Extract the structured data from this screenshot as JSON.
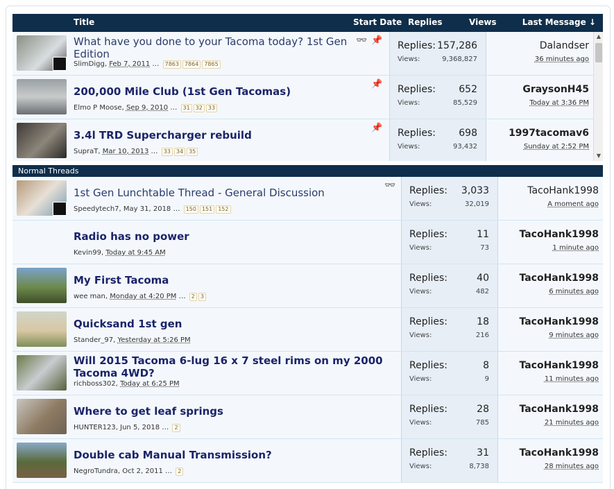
{
  "header": {
    "title": "Title",
    "start_date": "Start Date",
    "replies": "Replies",
    "views": "Views",
    "last_message": "Last Message ↓"
  },
  "sticky": [
    {
      "title": "What have you done to your Tacoma today? 1st Gen Edition",
      "author": "SlimDigg",
      "date": "Feb 7, 2011",
      "pages": [
        "7863",
        "7864",
        "7865"
      ],
      "replies": "157,286",
      "views": "9,368,827",
      "last_user": "Dalandser",
      "last_time": "36 minutes ago",
      "watched": true,
      "pinned": true,
      "light": true
    },
    {
      "title": "200,000 Mile Club (1st Gen Tacomas)",
      "author": "Elmo P Moose",
      "date": "Sep 9, 2010",
      "pages": [
        "31",
        "32",
        "33"
      ],
      "replies": "652",
      "views": "85,529",
      "last_user": "GraysonH45",
      "last_time": "Today at 3:36 PM",
      "watched": false,
      "pinned": true,
      "light": false
    },
    {
      "title": "3.4l TRD Supercharger rebuild",
      "author": "SupraT",
      "date": "Mar 10, 2013",
      "pages": [
        "33",
        "34",
        "35"
      ],
      "replies": "698",
      "views": "93,432",
      "last_user": "1997tacomav6",
      "last_time": "Sunday at 2:52 PM",
      "watched": false,
      "pinned": true,
      "light": false
    }
  ],
  "section_label": "Normal Threads",
  "labels": {
    "replies": "Replies:",
    "views": "Views:",
    "ellipsis": "…"
  },
  "threads": [
    {
      "title": "1st Gen Lunchtable Thread - General Discussion",
      "author": "Speedytech7",
      "date": "May 31, 2018",
      "pages": [
        "150",
        "151",
        "152"
      ],
      "replies": "3,033",
      "views": "32,019",
      "last_user": "TacoHank1998",
      "last_time": "A moment ago",
      "watched": true,
      "light": true
    },
    {
      "title": "Radio has no power",
      "author": "Kevin99",
      "date": "Today at 9:45 AM",
      "pages": [],
      "replies": "11",
      "views": "73",
      "last_user": "TacoHank1998",
      "last_time": "1 minute ago",
      "watched": false,
      "light": false
    },
    {
      "title": "My First Tacoma",
      "author": "wee man",
      "date": "Monday at 4:20 PM",
      "pages": [
        "2",
        "3"
      ],
      "replies": "40",
      "views": "482",
      "last_user": "TacoHank1998",
      "last_time": "6 minutes ago",
      "watched": false,
      "light": false
    },
    {
      "title": "Quicksand 1st gen",
      "author": "Stander_97",
      "date": "Yesterday at 5:26 PM",
      "pages": [],
      "replies": "18",
      "views": "216",
      "last_user": "TacoHank1998",
      "last_time": "9 minutes ago",
      "watched": false,
      "light": false
    },
    {
      "title": "Will 2015 Tacoma 6-lug 16 x 7 steel rims on my 2000",
      "title2": "Tacoma 4WD?",
      "author": "richboss302",
      "date": "Today at 6:25 PM",
      "pages": [],
      "replies": "8",
      "views": "9",
      "last_user": "TacoHank1998",
      "last_time": "11 minutes ago",
      "watched": false,
      "light": false
    },
    {
      "title": "Where to get leaf springs",
      "author": "HUNTER123",
      "date": "Jun 5, 2018",
      "pages": [
        "2"
      ],
      "replies": "28",
      "views": "785",
      "last_user": "TacoHank1998",
      "last_time": "21 minutes ago",
      "watched": false,
      "light": false
    },
    {
      "title": "Double cab Manual Transmission?",
      "author": "NegroTundra",
      "date": "Oct 2, 2011",
      "pages": [
        "2"
      ],
      "replies": "31",
      "views": "8,738",
      "last_user": "TacoHank1998",
      "last_time": "28 minutes ago",
      "watched": false,
      "light": false
    }
  ]
}
